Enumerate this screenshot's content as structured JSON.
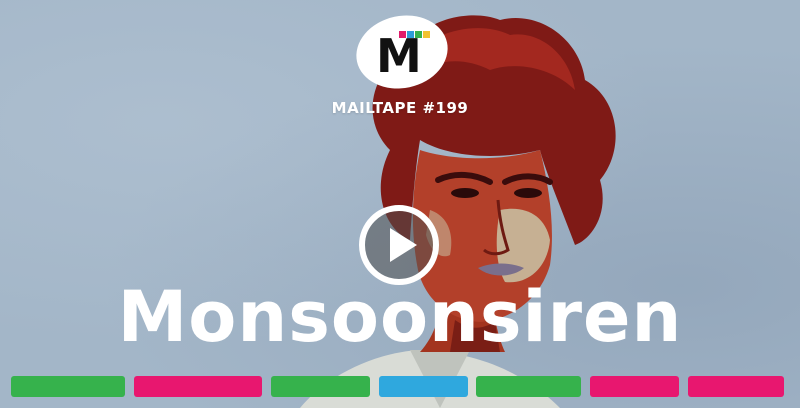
{
  "logo": {
    "letter": "M",
    "accent_colors": [
      "#e01c6b",
      "#2d9cd8",
      "#37b24d",
      "#f2c230"
    ]
  },
  "episode_label": "MAILTAPE #199",
  "artist_name": "Monsoonsiren",
  "icons": {
    "play": "play-icon",
    "logo": "mailtape-logo-icon"
  },
  "background_color": "#a3b6c8",
  "bar_colors": {
    "green": "#36b24c",
    "pink": "#e8176f",
    "blue": "#2fa8de"
  },
  "track_bars": [
    "green",
    "pink",
    "green",
    "blue",
    "green",
    "pink",
    "pink"
  ]
}
